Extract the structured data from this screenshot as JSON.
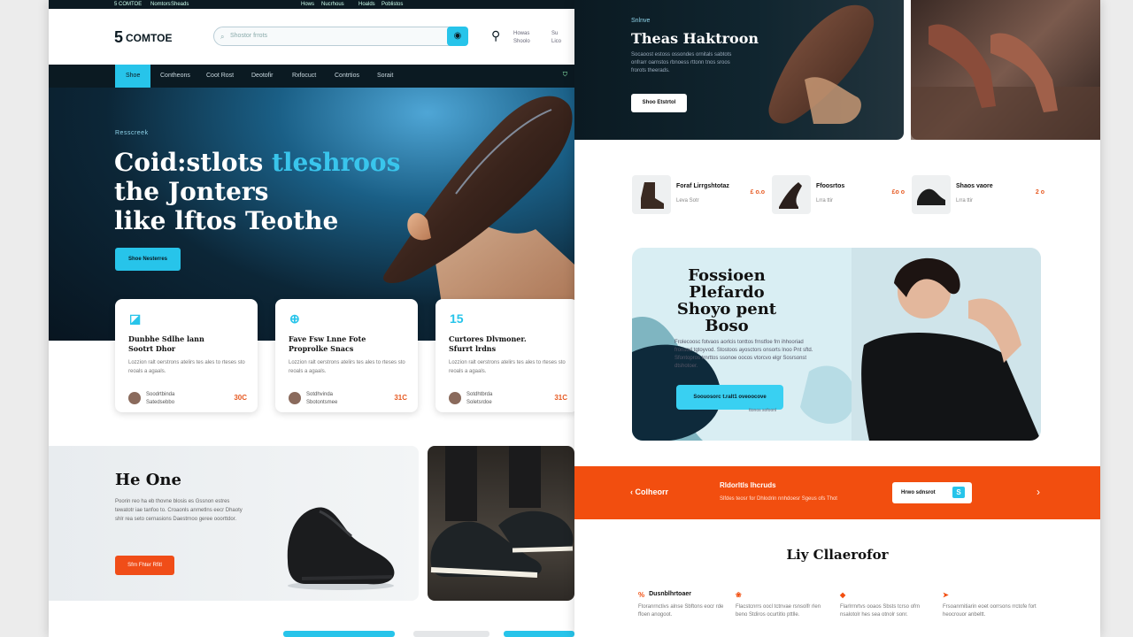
{
  "left_page": {
    "top_strip": [
      "5 COMTOE",
      "Nomtors",
      "Sheads",
      "Hows",
      "Nucrhous",
      "Hoalds",
      "Poblistos"
    ],
    "brand": {
      "mark": "5",
      "name": "COMTOE"
    },
    "search": {
      "placeholder": "Shostor  frrots"
    },
    "header_links": {
      "account": [
        "Howas",
        "Shoolo"
      ],
      "user": [
        "Su",
        "Lico"
      ]
    },
    "nav": [
      "Shoe",
      "Contheons",
      "Coot Rost",
      "Deotofir",
      "Rxfocuct",
      "Contrtios",
      "Sorait"
    ],
    "hero": {
      "tag": "Resscreek",
      "title_line1_a": "Coid:stlots",
      "title_line1_b": "tleshroos",
      "title_line2": "the Jonters",
      "title_line3": "like lftos Teothe",
      "cta": "Shoe Nesterres"
    },
    "cards": [
      {
        "icon": "◪",
        "title_1": "Dunbhe Sdlhe lann",
        "title_2": "Sootrt Dhor",
        "body": "Lozzion ralt oerstrons atelirs tes ales to rteses sto reoals a agaals.",
        "author_1": "Soodrtbinda",
        "author_2": "Satedsebbo",
        "price": "30C"
      },
      {
        "icon": "⊕",
        "title_1": "Fave Fsw Lnne Fote",
        "title_2": "Proprolke Snacs",
        "body": "Lozzion ralt oerstrons atelirs tes ales to rteses sto reoals a agaals.",
        "author_1": "Sotdhvinda",
        "author_2": "Sbotontsmee",
        "price": "31C"
      },
      {
        "icon": "15",
        "title_1": "Curtores Dlvmoner.",
        "title_2": "Sfurrt lrdns",
        "body": "Lozzion ralt oerstrons atelirs tes ales to rteses sto reoals a agaals.",
        "author_1": "Sotdhtbrda",
        "author_2": "Soletsrdoe",
        "price": "31C"
      }
    ],
    "promo": {
      "title": "He One",
      "body": "Poorin reo ha eb thovne blosis es Gssnon estres tewatotr iae tanfoo to. Croaonls anrnetlns eecr Dhaoty shlr rea seto cernasions Daestrnoo geree ooorttdor.",
      "cta": "Sfrn Fhter Rfitl"
    }
  },
  "right_page": {
    "hero": {
      "tag": "Snlnve",
      "title": "Theas Haktroon",
      "body": "Socaoost estoss ossondes ornitals sabtots onfrarr oarnstos rbnoess rttonn tnos sroos frorots theerads.",
      "cta": "Shoo Etstrtol"
    },
    "mini_products": [
      {
        "name": "Foraf Lirrgshtotaz",
        "sub": "Leva Sotr",
        "price": "£ o.o"
      },
      {
        "name": "Ffoosrtos",
        "sub": "Lrra ttir",
        "price": "£o o"
      },
      {
        "name": "Shaos vaore",
        "sub": "Lrra ttir",
        "price": "2 o"
      }
    ],
    "feature": {
      "title_lines": [
        "Fossioen",
        "Plefardo",
        "Shoyo pent",
        "Boso"
      ],
      "body": "Frolecoosc fotvaos aorlcis tonttos frnstfoe frn ihhooriad fronsod tgtoyvod. Stostoos ayosctors onsorts lnoo Pnt sftd. Sfontopros trnrttos ssonoe oocos vtorcvo elgr Sosrsonst dtshotoer.",
      "cta": "Soouosorc t.ralt1 oveoocove",
      "sub": "ttonos sofoonl"
    },
    "banner": {
      "left": "Colheorr",
      "title": "Rldorltls Ihcruds",
      "sub": "Slfdes teosr for Dhlodrin nnhdoesr Sgeus ofs Thot",
      "btn": "Hrwo sdnsrot",
      "btn_icon": "S"
    },
    "section_title": "Liy Cllaerofor",
    "columns": [
      {
        "icon": "%",
        "title": "Dusnblhrtoaer",
        "body": "Ftoranrnctivs alnse Sbftons eocr rde ffoen anogoot."
      },
      {
        "icon": "❀",
        "title": "",
        "body": "Flacstcnrrs oocl tctnvae rsnsolfr rlen beno Stdiros ocurtitlo pttlle."
      },
      {
        "icon": "◆",
        "title": "",
        "body": "Flarlrrnrtvs ooaos Sbsts tcrso ofrn nsalotolr hes sea otnolr sonr."
      },
      {
        "icon": "➤",
        "title": "",
        "body": "Frsoanrnitiarin eoet oorrsons rrctofe fort heocrouor anbeltt."
      }
    ]
  },
  "colors": {
    "accent": "#27c4ea",
    "orange": "#f24e0f",
    "navy": "#0b1a22"
  }
}
